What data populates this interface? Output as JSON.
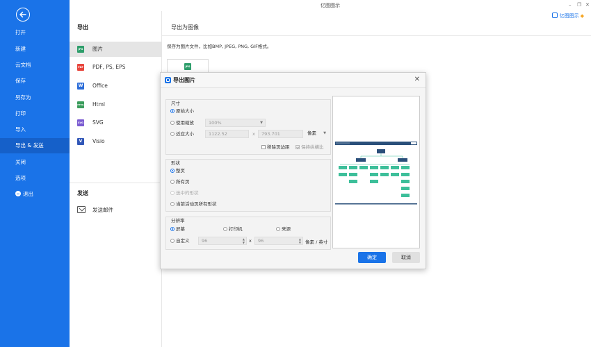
{
  "app": {
    "title": "亿图图示",
    "brand": "亿图图示"
  },
  "sidebar": {
    "items": [
      {
        "label": "打开"
      },
      {
        "label": "新建"
      },
      {
        "label": "云文档"
      },
      {
        "label": "保存"
      },
      {
        "label": "另存为"
      },
      {
        "label": "打印"
      },
      {
        "label": "导入"
      },
      {
        "label": "导出 & 发送",
        "active": true
      },
      {
        "label": "关闭"
      },
      {
        "label": "选项"
      },
      {
        "label": "退出"
      }
    ]
  },
  "export_panel": {
    "title": "导出",
    "formats": [
      {
        "label": "图片",
        "icon": "jpg-icon",
        "tag": "JPG",
        "color": "#2e9e6b",
        "active": true
      },
      {
        "label": "PDF, PS, EPS",
        "icon": "pdf-icon",
        "tag": "PDF",
        "color": "#e8453c"
      },
      {
        "label": "Office",
        "icon": "word-icon",
        "tag": "W",
        "color": "#2b6cd8"
      },
      {
        "label": "Html",
        "icon": "html-icon",
        "tag": "HTML",
        "color": "#3a9c5c"
      },
      {
        "label": "SVG",
        "icon": "svg-icon",
        "tag": "SVG",
        "color": "#7a5bd1"
      },
      {
        "label": "Visio",
        "icon": "visio-icon",
        "tag": "V",
        "color": "#3157b8"
      }
    ],
    "send_title": "发送",
    "send_mail": "发送邮件"
  },
  "main": {
    "heading": "导出为图像",
    "description": "保存为图片文件，比如BMP, JPEG, PNG, GIF格式。",
    "thumb_tag": "JPG"
  },
  "dialog": {
    "title": "导出图片",
    "size": {
      "title": "尺寸",
      "original": "原始大小",
      "use_scale": "使用缩放",
      "scale_value": "100%",
      "fit_size": "适应大小",
      "width": "1122.52",
      "x": "x",
      "height": "793.701",
      "unit": "像素",
      "remove_margin": "移除页边距",
      "keep_ratio": "保持纵横比"
    },
    "shape": {
      "title": "形状",
      "whole_page": "整页",
      "all_pages": "所有页",
      "selected": "选中的形状",
      "current_all": "当前活动页所有形状"
    },
    "resolution": {
      "title": "分辨率",
      "screen": "屏幕",
      "printer": "打印机",
      "source": "来源",
      "custom": "自定义",
      "dpi_x": "96",
      "x": "x",
      "dpi_y": "96",
      "unit": "像素 / 英寸"
    },
    "ok": "确定",
    "cancel": "取消"
  },
  "colors": {
    "accent": "#1a73e8",
    "preview_node": "#3dbf9a",
    "preview_header": "#2a4f7a"
  }
}
